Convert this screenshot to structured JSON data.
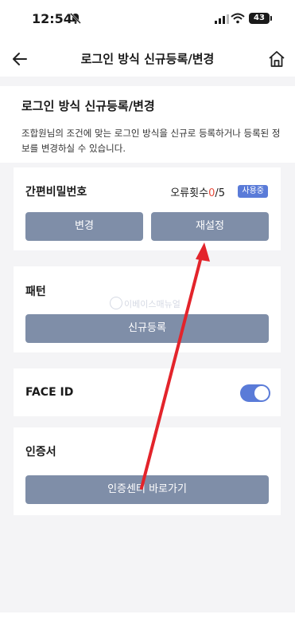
{
  "status_bar": {
    "time": "12:54",
    "battery": "43"
  },
  "nav": {
    "title": "로그인 방식 신규등록/변경"
  },
  "intro": {
    "title": "로그인 방식 신규등록/변경",
    "description": "조합원님의 조건에 맞는 로그인 방식을 신규로 등록하거나 등록된 정보를 변경하실 수 있습니다."
  },
  "simple_password": {
    "title": "간편비밀번호",
    "error_label": "오류횟수",
    "error_count": "0",
    "error_max": "/5",
    "status_badge": "사용중",
    "change_button": "변경",
    "reset_button": "재설정"
  },
  "pattern": {
    "title": "패턴",
    "register_button": "신규등록"
  },
  "face_id": {
    "title": "FACE ID",
    "enabled": true
  },
  "certificate": {
    "title": "인증서",
    "center_button": "인증센터 바로가기"
  },
  "watermark": {
    "text": "이베이스매뉴얼"
  },
  "colors": {
    "button": "#7f8ea8",
    "accent": "#5a7bd8",
    "annotation": "#e3242b"
  }
}
